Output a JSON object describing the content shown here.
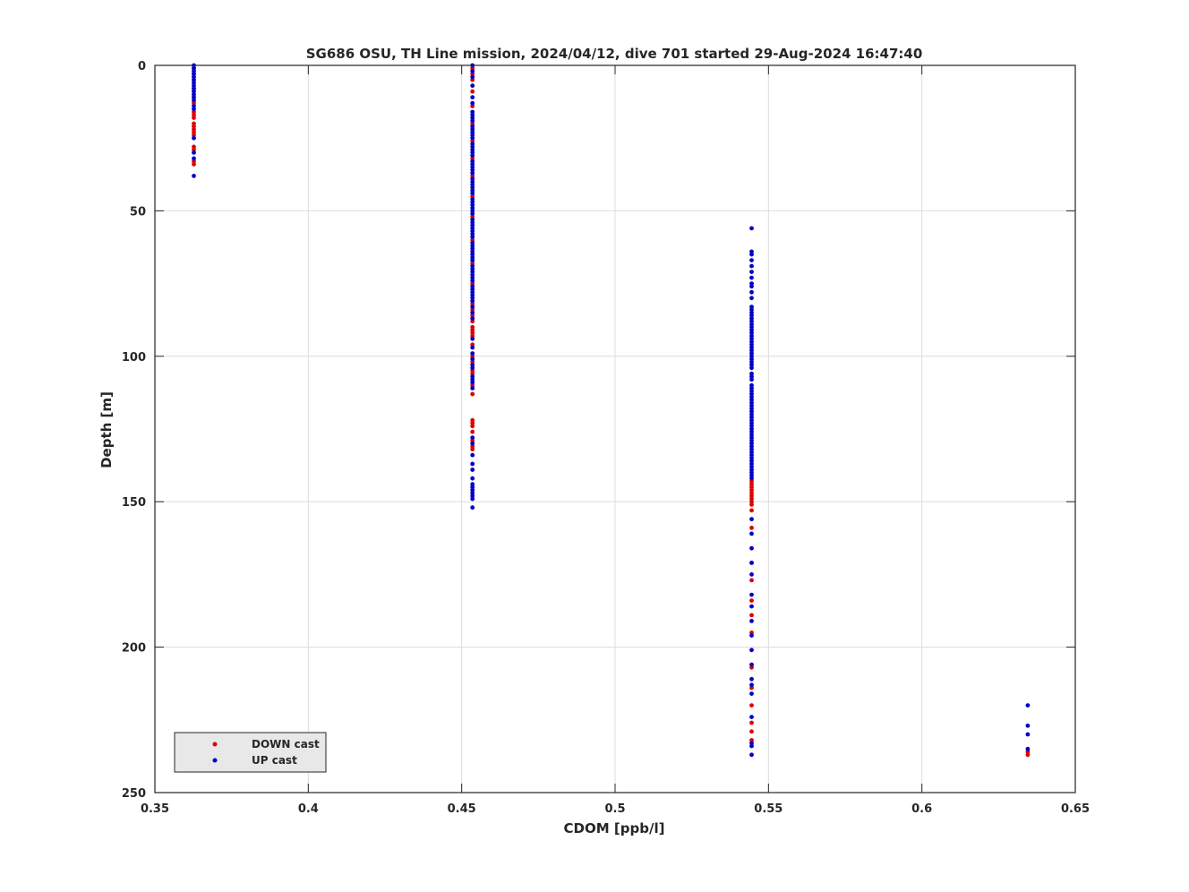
{
  "chart_data": {
    "type": "scatter",
    "title": "SG686 OSU, TH Line mission, 2024/04/12, dive 701 started 29-Aug-2024 16:47:40",
    "xlabel": "CDOM [ppb/l]",
    "ylabel": "Depth [m]",
    "xlim": [
      0.35,
      0.65
    ],
    "ylim": [
      0,
      250
    ],
    "y_reversed": true,
    "grid": true,
    "legend_position": "bottom-left",
    "xticks": [
      "0.35",
      "0.4",
      "0.45",
      "0.5",
      "0.55",
      "0.6",
      "0.65"
    ],
    "yticks": [
      "0",
      "50",
      "100",
      "150",
      "200",
      "250"
    ],
    "series": [
      {
        "name": "DOWN cast",
        "color": "#e00000",
        "points": [
          [
            0.3627,
            1
          ],
          [
            0.3627,
            3
          ],
          [
            0.3627,
            5
          ],
          [
            0.3627,
            8
          ],
          [
            0.3627,
            11
          ],
          [
            0.3627,
            13
          ],
          [
            0.3627,
            16
          ],
          [
            0.3627,
            17
          ],
          [
            0.3627,
            18
          ],
          [
            0.3627,
            20
          ],
          [
            0.3627,
            21
          ],
          [
            0.3627,
            22
          ],
          [
            0.3627,
            23
          ],
          [
            0.3627,
            24
          ],
          [
            0.3627,
            28
          ],
          [
            0.3627,
            29
          ],
          [
            0.3627,
            33
          ],
          [
            0.3627,
            34
          ],
          [
            0.4535,
            1
          ],
          [
            0.4535,
            3
          ],
          [
            0.4535,
            5
          ],
          [
            0.4535,
            9
          ],
          [
            0.4535,
            14
          ],
          [
            0.4535,
            20
          ],
          [
            0.4535,
            26
          ],
          [
            0.4535,
            32
          ],
          [
            0.4535,
            38
          ],
          [
            0.4535,
            45
          ],
          [
            0.4535,
            52
          ],
          [
            0.4535,
            60
          ],
          [
            0.4535,
            68
          ],
          [
            0.4535,
            75
          ],
          [
            0.4535,
            82
          ],
          [
            0.4535,
            84
          ],
          [
            0.4535,
            86
          ],
          [
            0.4535,
            88
          ],
          [
            0.4535,
            90
          ],
          [
            0.4535,
            91
          ],
          [
            0.4535,
            92
          ],
          [
            0.4535,
            93
          ],
          [
            0.4535,
            96
          ],
          [
            0.4535,
            100
          ],
          [
            0.4535,
            102
          ],
          [
            0.4535,
            105
          ],
          [
            0.4535,
            106
          ],
          [
            0.4535,
            110
          ],
          [
            0.4535,
            113
          ],
          [
            0.4535,
            122
          ],
          [
            0.4535,
            123
          ],
          [
            0.4535,
            124
          ],
          [
            0.4535,
            126
          ],
          [
            0.4535,
            129
          ],
          [
            0.4535,
            131
          ],
          [
            0.4535,
            132
          ],
          [
            0.5445,
            143
          ],
          [
            0.5445,
            144
          ],
          [
            0.5445,
            145
          ],
          [
            0.5445,
            146
          ],
          [
            0.5445,
            147
          ],
          [
            0.5445,
            148
          ],
          [
            0.5445,
            149
          ],
          [
            0.5445,
            150
          ],
          [
            0.5445,
            151
          ],
          [
            0.5445,
            153
          ],
          [
            0.5445,
            159
          ],
          [
            0.5445,
            171
          ],
          [
            0.5445,
            177
          ],
          [
            0.5445,
            184
          ],
          [
            0.5445,
            189
          ],
          [
            0.5445,
            195
          ],
          [
            0.5445,
            207
          ],
          [
            0.5445,
            214
          ],
          [
            0.5445,
            220
          ],
          [
            0.5445,
            226
          ],
          [
            0.5445,
            229
          ],
          [
            0.5445,
            232
          ],
          [
            0.6345,
            236
          ],
          [
            0.6345,
            237
          ]
        ]
      },
      {
        "name": "UP cast",
        "color": "#0000c8",
        "points": [
          [
            0.3627,
            0
          ],
          [
            0.3627,
            1
          ],
          [
            0.3627,
            2
          ],
          [
            0.3627,
            3
          ],
          [
            0.3627,
            4
          ],
          [
            0.3627,
            5
          ],
          [
            0.3627,
            6
          ],
          [
            0.3627,
            7
          ],
          [
            0.3627,
            8
          ],
          [
            0.3627,
            9
          ],
          [
            0.3627,
            10
          ],
          [
            0.3627,
            11
          ],
          [
            0.3627,
            12
          ],
          [
            0.3627,
            14
          ],
          [
            0.3627,
            15
          ],
          [
            0.3627,
            25
          ],
          [
            0.3627,
            30
          ],
          [
            0.3627,
            32
          ],
          [
            0.3627,
            38
          ],
          [
            0.4535,
            0
          ],
          [
            0.4535,
            2
          ],
          [
            0.4535,
            4
          ],
          [
            0.4535,
            7
          ],
          [
            0.4535,
            11
          ],
          [
            0.4535,
            13
          ],
          [
            0.4535,
            16
          ],
          [
            0.4535,
            17
          ],
          [
            0.4535,
            18
          ],
          [
            0.4535,
            19
          ],
          [
            0.4535,
            21
          ],
          [
            0.4535,
            22
          ],
          [
            0.4535,
            23
          ],
          [
            0.4535,
            24
          ],
          [
            0.4535,
            25
          ],
          [
            0.4535,
            27
          ],
          [
            0.4535,
            28
          ],
          [
            0.4535,
            29
          ],
          [
            0.4535,
            30
          ],
          [
            0.4535,
            31
          ],
          [
            0.4535,
            33
          ],
          [
            0.4535,
            34
          ],
          [
            0.4535,
            35
          ],
          [
            0.4535,
            36
          ],
          [
            0.4535,
            37
          ],
          [
            0.4535,
            39
          ],
          [
            0.4535,
            40
          ],
          [
            0.4535,
            41
          ],
          [
            0.4535,
            42
          ],
          [
            0.4535,
            43
          ],
          [
            0.4535,
            44
          ],
          [
            0.4535,
            46
          ],
          [
            0.4535,
            47
          ],
          [
            0.4535,
            48
          ],
          [
            0.4535,
            49
          ],
          [
            0.4535,
            50
          ],
          [
            0.4535,
            51
          ],
          [
            0.4535,
            53
          ],
          [
            0.4535,
            54
          ],
          [
            0.4535,
            55
          ],
          [
            0.4535,
            56
          ],
          [
            0.4535,
            57
          ],
          [
            0.4535,
            58
          ],
          [
            0.4535,
            59
          ],
          [
            0.4535,
            61
          ],
          [
            0.4535,
            62
          ],
          [
            0.4535,
            63
          ],
          [
            0.4535,
            64
          ],
          [
            0.4535,
            65
          ],
          [
            0.4535,
            66
          ],
          [
            0.4535,
            67
          ],
          [
            0.4535,
            69
          ],
          [
            0.4535,
            70
          ],
          [
            0.4535,
            71
          ],
          [
            0.4535,
            72
          ],
          [
            0.4535,
            73
          ],
          [
            0.4535,
            74
          ],
          [
            0.4535,
            76
          ],
          [
            0.4535,
            77
          ],
          [
            0.4535,
            78
          ],
          [
            0.4535,
            79
          ],
          [
            0.4535,
            80
          ],
          [
            0.4535,
            81
          ],
          [
            0.4535,
            83
          ],
          [
            0.4535,
            85
          ],
          [
            0.4535,
            87
          ],
          [
            0.4535,
            94
          ],
          [
            0.4535,
            97
          ],
          [
            0.4535,
            99
          ],
          [
            0.4535,
            101
          ],
          [
            0.4535,
            103
          ],
          [
            0.4535,
            104
          ],
          [
            0.4535,
            107
          ],
          [
            0.4535,
            108
          ],
          [
            0.4535,
            109
          ],
          [
            0.4535,
            111
          ],
          [
            0.4535,
            128
          ],
          [
            0.4535,
            130
          ],
          [
            0.4535,
            134
          ],
          [
            0.4535,
            137
          ],
          [
            0.4535,
            139
          ],
          [
            0.4535,
            142
          ],
          [
            0.4535,
            144
          ],
          [
            0.4535,
            145
          ],
          [
            0.4535,
            146
          ],
          [
            0.4535,
            147
          ],
          [
            0.4535,
            148
          ],
          [
            0.4535,
            149
          ],
          [
            0.4535,
            152
          ],
          [
            0.5445,
            56
          ],
          [
            0.5445,
            64
          ],
          [
            0.5445,
            65
          ],
          [
            0.5445,
            67
          ],
          [
            0.5445,
            69
          ],
          [
            0.5445,
            71
          ],
          [
            0.5445,
            73
          ],
          [
            0.5445,
            75
          ],
          [
            0.5445,
            76
          ],
          [
            0.5445,
            78
          ],
          [
            0.5445,
            80
          ],
          [
            0.5445,
            83
          ],
          [
            0.5445,
            84
          ],
          [
            0.5445,
            85
          ],
          [
            0.5445,
            86
          ],
          [
            0.5445,
            87
          ],
          [
            0.5445,
            88
          ],
          [
            0.5445,
            89
          ],
          [
            0.5445,
            90
          ],
          [
            0.5445,
            91
          ],
          [
            0.5445,
            92
          ],
          [
            0.5445,
            93
          ],
          [
            0.5445,
            94
          ],
          [
            0.5445,
            95
          ],
          [
            0.5445,
            96
          ],
          [
            0.5445,
            97
          ],
          [
            0.5445,
            98
          ],
          [
            0.5445,
            99
          ],
          [
            0.5445,
            100
          ],
          [
            0.5445,
            101
          ],
          [
            0.5445,
            102
          ],
          [
            0.5445,
            103
          ],
          [
            0.5445,
            104
          ],
          [
            0.5445,
            106
          ],
          [
            0.5445,
            107
          ],
          [
            0.5445,
            108
          ],
          [
            0.5445,
            110
          ],
          [
            0.5445,
            111
          ],
          [
            0.5445,
            112
          ],
          [
            0.5445,
            113
          ],
          [
            0.5445,
            114
          ],
          [
            0.5445,
            115
          ],
          [
            0.5445,
            116
          ],
          [
            0.5445,
            117
          ],
          [
            0.5445,
            118
          ],
          [
            0.5445,
            119
          ],
          [
            0.5445,
            120
          ],
          [
            0.5445,
            121
          ],
          [
            0.5445,
            122
          ],
          [
            0.5445,
            123
          ],
          [
            0.5445,
            124
          ],
          [
            0.5445,
            125
          ],
          [
            0.5445,
            126
          ],
          [
            0.5445,
            127
          ],
          [
            0.5445,
            128
          ],
          [
            0.5445,
            129
          ],
          [
            0.5445,
            130
          ],
          [
            0.5445,
            131
          ],
          [
            0.5445,
            132
          ],
          [
            0.5445,
            133
          ],
          [
            0.5445,
            134
          ],
          [
            0.5445,
            135
          ],
          [
            0.5445,
            136
          ],
          [
            0.5445,
            137
          ],
          [
            0.5445,
            138
          ],
          [
            0.5445,
            139
          ],
          [
            0.5445,
            140
          ],
          [
            0.5445,
            141
          ],
          [
            0.5445,
            142
          ],
          [
            0.5445,
            156
          ],
          [
            0.5445,
            161
          ],
          [
            0.5445,
            166
          ],
          [
            0.5445,
            171
          ],
          [
            0.5445,
            175
          ],
          [
            0.5445,
            182
          ],
          [
            0.5445,
            186
          ],
          [
            0.5445,
            191
          ],
          [
            0.5445,
            196
          ],
          [
            0.5445,
            201
          ],
          [
            0.5445,
            206
          ],
          [
            0.5445,
            211
          ],
          [
            0.5445,
            213
          ],
          [
            0.5445,
            216
          ],
          [
            0.5445,
            224
          ],
          [
            0.5445,
            233
          ],
          [
            0.5445,
            234
          ],
          [
            0.5445,
            237
          ],
          [
            0.6345,
            220
          ],
          [
            0.6345,
            227
          ],
          [
            0.6345,
            230
          ],
          [
            0.6345,
            235
          ]
        ]
      }
    ]
  }
}
